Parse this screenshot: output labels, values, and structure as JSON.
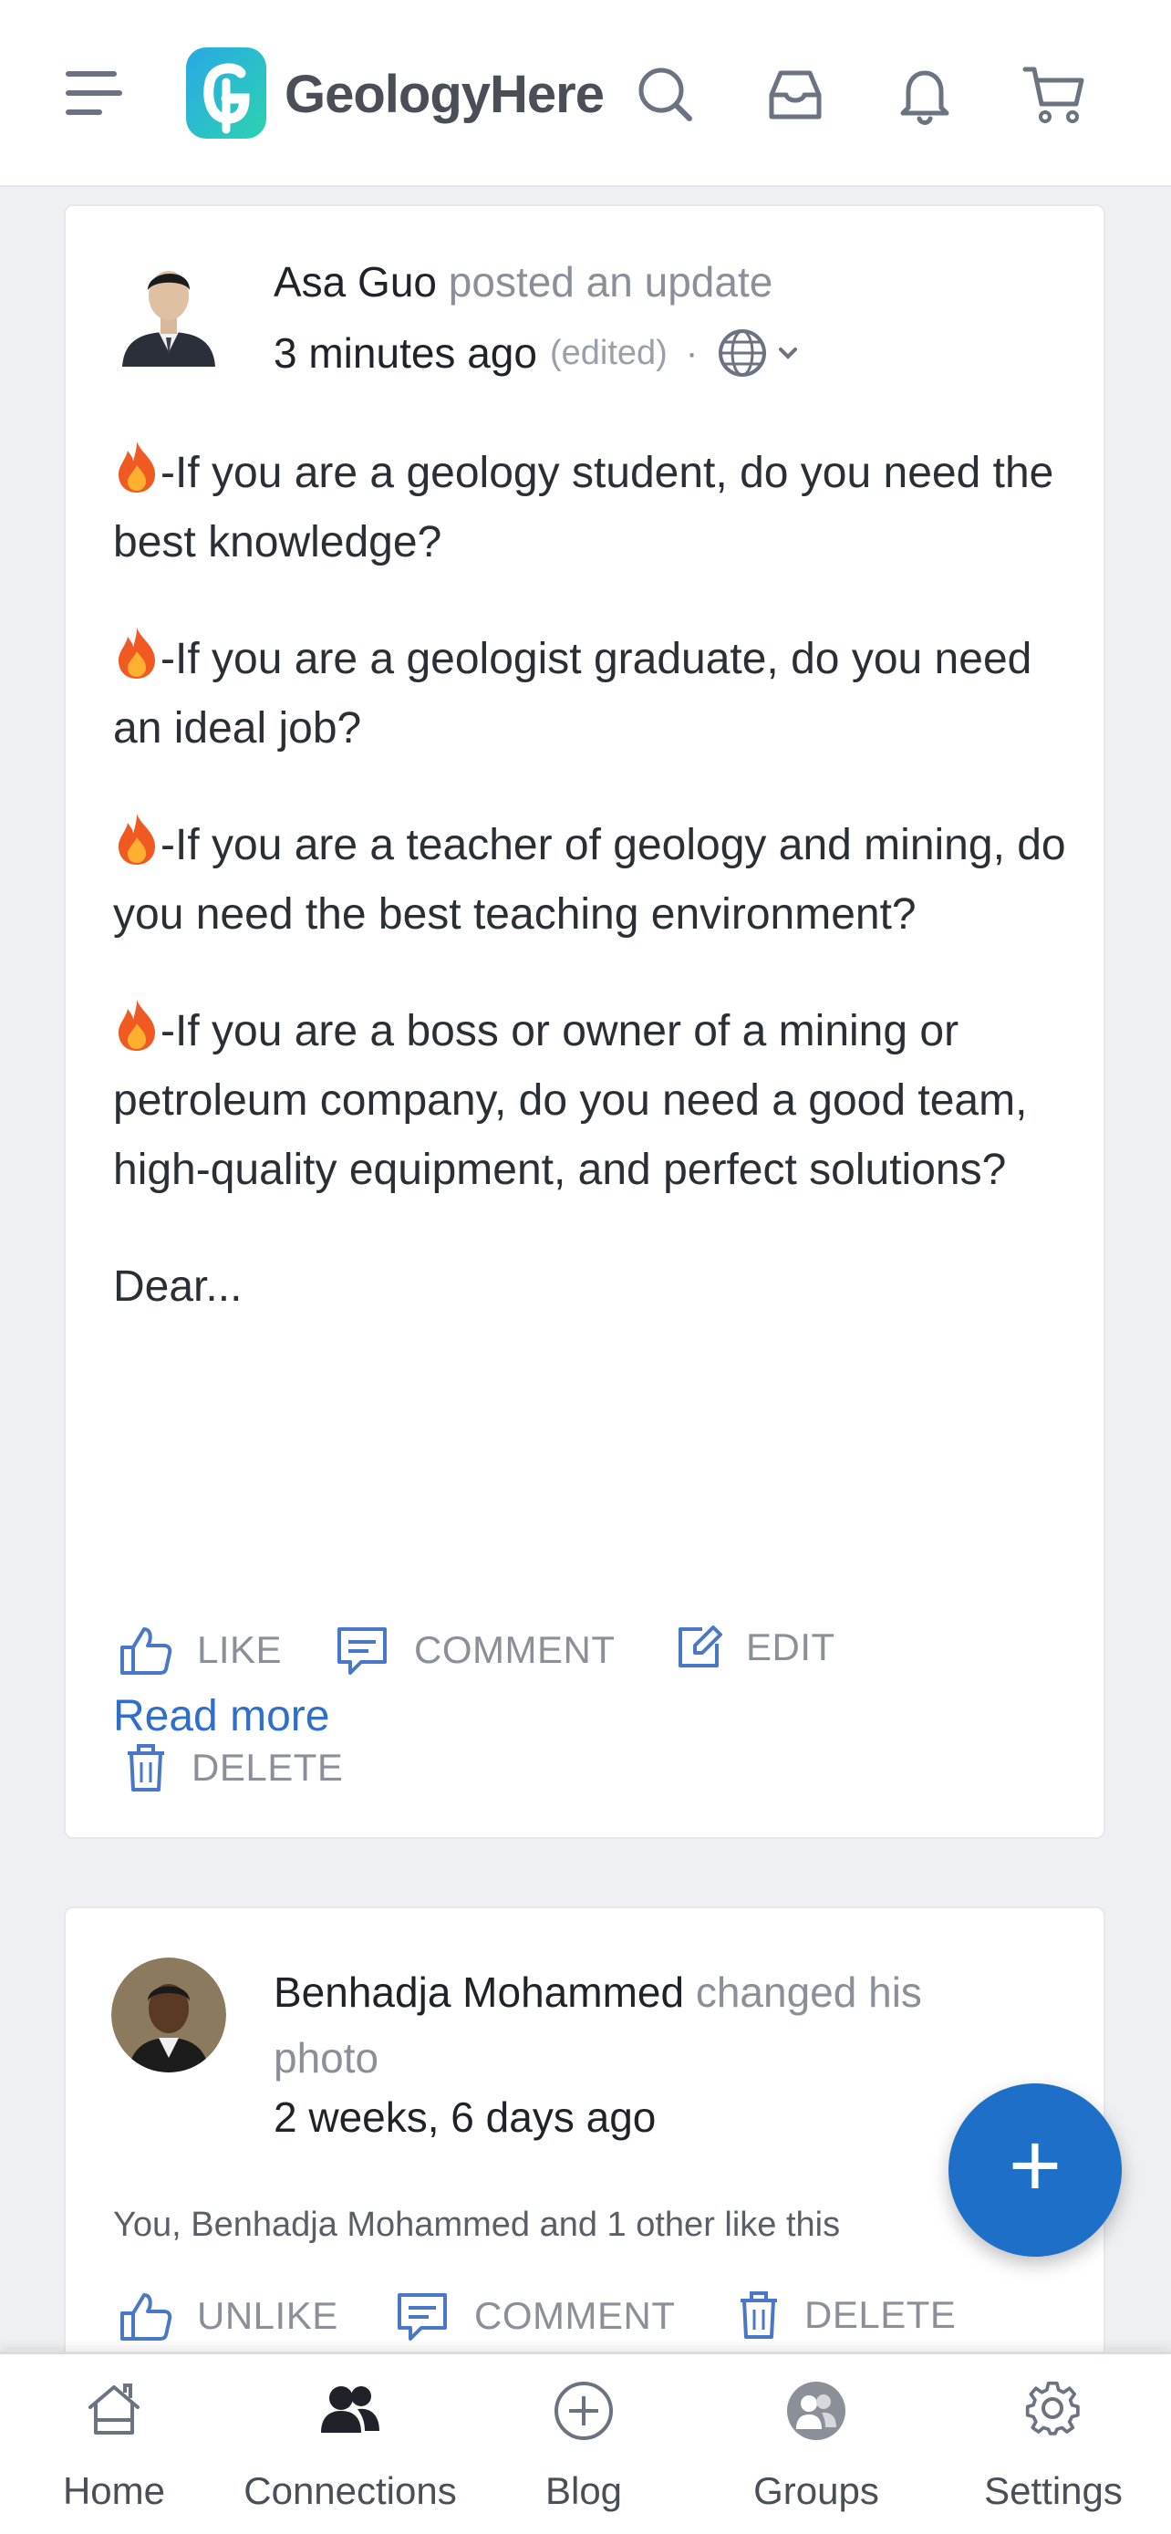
{
  "header": {
    "brand": "GeologyHere",
    "brand_color": "#22b8d6",
    "icons": [
      "menu-icon",
      "search-icon",
      "inbox-icon",
      "bell-icon",
      "cart-icon"
    ]
  },
  "feed": [
    {
      "author": "Asa Guo",
      "action": "posted an update",
      "time": "3 minutes ago",
      "edited": "(edited)",
      "separator": "·",
      "visibility_icon": "globe-icon",
      "paragraphs": [
        "-If you are a geology student, do you need the best knowledge?",
        "-If you are a geologist graduate, do you need an ideal job?",
        "-If you are a teacher of geology and mining, do you need the best teaching environment?",
        "-If you are a boss or owner of a mining or petroleum company, do you need a good team, high-quality equipment, and perfect solutions?",
        "Dear..."
      ],
      "read_more": "Read more",
      "actions": {
        "like": "LIKE",
        "comment": "COMMENT",
        "edit": "EDIT",
        "delete": "DELETE"
      }
    },
    {
      "author": "Benhadja Mohammed",
      "action": "changed his photo",
      "time": "2 weeks, 6 days ago",
      "likes_text": "You, Benhadja Mohammed and 1 other like this",
      "actions": {
        "unlike": "UNLIKE",
        "comment": "COMMENT",
        "delete": "DELETE"
      }
    }
  ],
  "fab": {
    "label": "+",
    "color": "#1e6fc8"
  },
  "bottom_nav": [
    {
      "label": "Home",
      "icon": "home-icon"
    },
    {
      "label": "Connections",
      "icon": "connections-icon"
    },
    {
      "label": "Blog",
      "icon": "plus-circle-icon"
    },
    {
      "label": "Groups",
      "icon": "groups-icon"
    },
    {
      "label": "Settings",
      "icon": "gear-icon"
    }
  ],
  "colors": {
    "link": "#2f6fcb",
    "action_icon": "#4a78c8",
    "muted_text": "#8a8f98"
  }
}
